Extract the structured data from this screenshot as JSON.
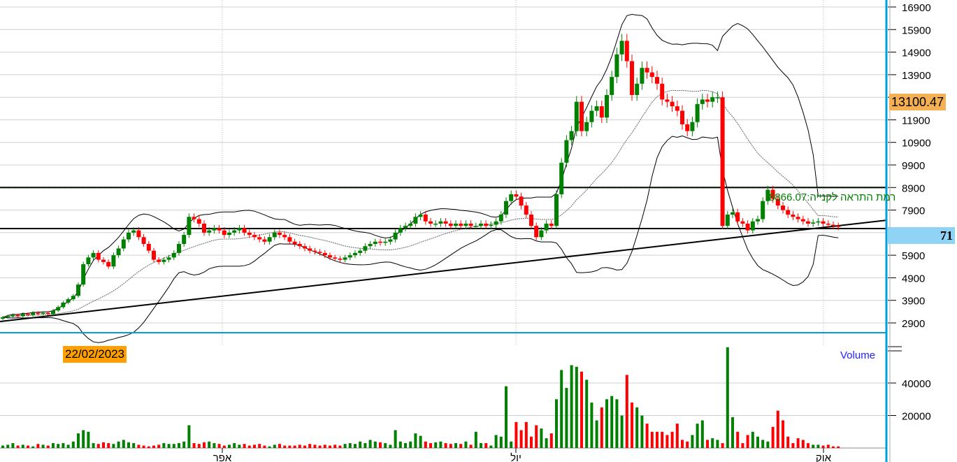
{
  "chart_data": {
    "type": "candlestick",
    "price_axis": {
      "ticks": [
        2900,
        3900,
        4900,
        5900,
        6900,
        7900,
        8900,
        9900,
        10900,
        11900,
        12900,
        13900,
        14900,
        15900,
        16900
      ],
      "range": [
        2900,
        16900
      ]
    },
    "volume_axis": {
      "ticks": [
        20000,
        40000
      ],
      "label": "Volume",
      "range": [
        0,
        62000
      ]
    },
    "x_tick_labels": [
      "אפר",
      "יול",
      "אוק"
    ],
    "closes": [
      3150,
      3200,
      3250,
      3200,
      3300,
      3250,
      3350,
      3300,
      3350,
      3300,
      3450,
      3600,
      3800,
      3950,
      4100,
      4600,
      5500,
      5800,
      6000,
      5700,
      5600,
      5400,
      5900,
      6200,
      6600,
      6900,
      7000,
      6700,
      6400,
      6100,
      5700,
      5600,
      5700,
      5800,
      6000,
      6400,
      6800,
      7600,
      7500,
      7300,
      6900,
      7000,
      7100,
      7000,
      6800,
      6900,
      7000,
      7100,
      6900,
      6800,
      6700,
      6600,
      6500,
      6700,
      6900,
      6800,
      6700,
      6500,
      6400,
      6300,
      6200,
      6100,
      6050,
      6000,
      5900,
      5800,
      5750,
      5700,
      5800,
      5900,
      6000,
      6100,
      6300,
      6400,
      6500,
      6450,
      6500,
      6600,
      6900,
      7100,
      7200,
      7300,
      7600,
      7700,
      7400,
      7300,
      7300,
      7400,
      7300,
      7200,
      7300,
      7200,
      7300,
      7200,
      7200,
      7300,
      7200,
      7250,
      7400,
      7700,
      8300,
      8600,
      8500,
      8100,
      7700,
      7200,
      6700,
      7000,
      7300,
      7200,
      8600,
      10000,
      11000,
      11400,
      12700,
      11400,
      11800,
      12300,
      12500,
      12000,
      13000,
      13800,
      14800,
      15400,
      14500,
      13000,
      13500,
      14200,
      14000,
      13800,
      13500,
      12800,
      12700,
      12500,
      12300,
      11700,
      11400,
      11800,
      12600,
      12800,
      12700,
      12900,
      12900,
      7200,
      7700,
      7800,
      7400,
      7300,
      7000,
      7400,
      7500,
      8300,
      8800,
      8400,
      8100,
      7900,
      7700,
      7600,
      7500,
      7400,
      7300,
      7350,
      7400,
      7300,
      7250,
      7200,
      7150
    ],
    "volumes": [
      1500,
      2000,
      3000,
      1500,
      2000,
      1500,
      1000,
      2500,
      2000,
      1500,
      3000,
      2500,
      3000,
      2000,
      4000,
      9000,
      11000,
      10000,
      3000,
      2500,
      3500,
      3000,
      2500,
      4000,
      5000,
      3500,
      3000,
      2000,
      1500,
      1000,
      1500,
      2000,
      3000,
      2500,
      2500,
      3000,
      4000,
      14000,
      3000,
      2500,
      3500,
      4000,
      3000,
      2500,
      1500,
      2000,
      3000,
      2000,
      2500,
      1500,
      2000,
      2500,
      1500,
      1000,
      2000,
      2500,
      1500,
      1500,
      1500,
      2000,
      1500,
      2500,
      2000,
      1500,
      2000,
      1500,
      2000,
      1500,
      2500,
      3000,
      2500,
      4000,
      3000,
      5000,
      4000,
      3500,
      3000,
      2000,
      11000,
      4000,
      3000,
      4000,
      9000,
      7500,
      4000,
      3000,
      3500,
      4000,
      3000,
      2500,
      3000,
      2500,
      4000,
      2000,
      10000,
      3000,
      3000,
      1500,
      8000,
      7000,
      38000,
      4000,
      16000,
      11000,
      16000,
      7000,
      14000,
      12000,
      6000,
      9000,
      30000,
      48000,
      37000,
      51000,
      50000,
      47000,
      42000,
      28000,
      17000,
      25000,
      30000,
      32000,
      30000,
      20000,
      45000,
      28000,
      25000,
      20000,
      15000,
      10000,
      10000,
      10000,
      8000,
      10000,
      15000,
      5000,
      4000,
      8000,
      15000,
      17000,
      5000,
      6000,
      5000,
      3000,
      62000,
      19000,
      10000,
      3000,
      8000,
      10000,
      7000,
      5000,
      4000,
      13000,
      23000,
      17000,
      7000,
      3000,
      6000,
      5000,
      3000,
      2000,
      2000,
      1500,
      2000,
      1000,
      1000
    ],
    "horizontal_lines": [
      8900,
      7080
    ],
    "trend_line": {
      "from": 2960,
      "to": 7450
    },
    "indicator": "Bollinger Bands",
    "colors": {
      "up": "#008000",
      "down": "#ff0000",
      "accent": "#00a0e0",
      "tag": "#ffa500"
    }
  },
  "labels": {
    "last_price": "13100.47",
    "cursor_value": "71",
    "date_tag": "22/02/2023",
    "alert_text": "רמת התראה לקנייה:8866.07",
    "alert_level": 8866.07
  }
}
